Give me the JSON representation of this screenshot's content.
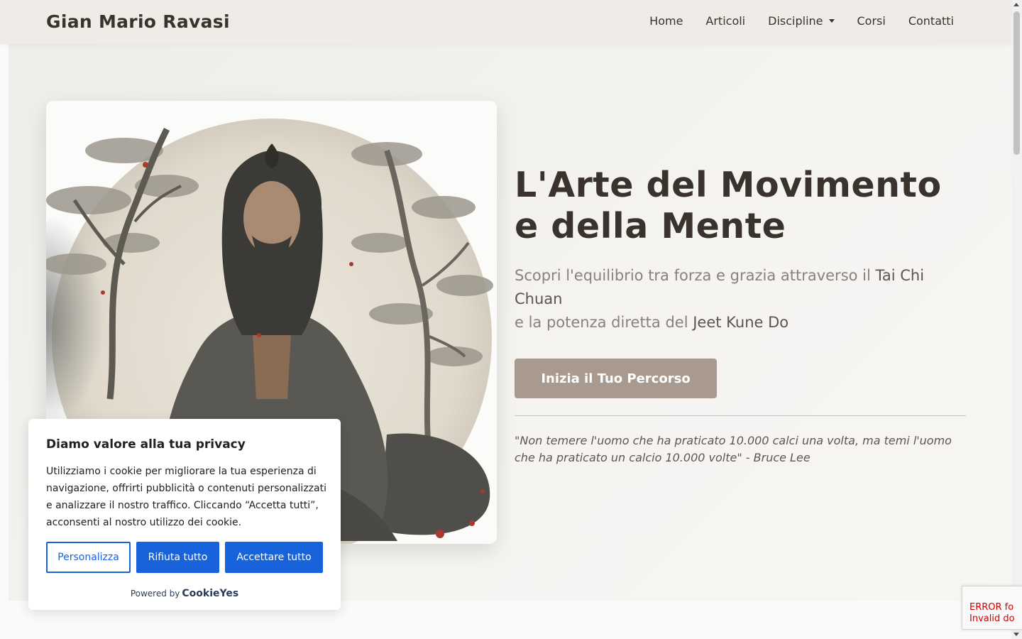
{
  "navbar": {
    "brand": "Gian Mario Ravasi",
    "links": [
      {
        "label": "Home"
      },
      {
        "label": "Articoli"
      },
      {
        "label": "Discipline"
      },
      {
        "label": "Corsi"
      },
      {
        "label": "Contatti"
      }
    ]
  },
  "hero": {
    "title_line1": "L'Arte del Movimento",
    "title_line2": "e della Mente",
    "sub_part1": "Scopri l'equilibrio tra forza e grazia attraverso il ",
    "sub_strong1": "Tai Chi Chuan",
    "sub_part2": "e la potenza diretta del ",
    "sub_strong2": "Jeet Kune Do",
    "cta_label": "Inizia il Tuo Percorso",
    "quote": "\"Non temere l'uomo che ha praticato 10.000 calci una volta, ma temi l'uomo che ha praticato un calcio 10.000 volte\" - Bruce Lee"
  },
  "cookie": {
    "title": "Diamo valore alla tua privacy",
    "text": "Utilizziamo i cookie per migliorare la tua esperienza di navigazione, offrirti pubblicità o contenuti personalizzati e analizzare il nostro traffico. Cliccando “Accetta tutti”, acconsenti al nostro utilizzo dei cookie.",
    "btn_customize": "Personalizza",
    "btn_reject": "Rifiuta tutto",
    "btn_accept": "Accettare tutto",
    "powered_by": "Powered by",
    "powered_logo": "CookieYes"
  },
  "recaptcha": {
    "line1": "ERROR fo",
    "line2": "Invalid do"
  },
  "colors": {
    "accent_button": "#a89a8f",
    "cookie_blue": "#1863dc",
    "text_dark": "#3a322d"
  }
}
